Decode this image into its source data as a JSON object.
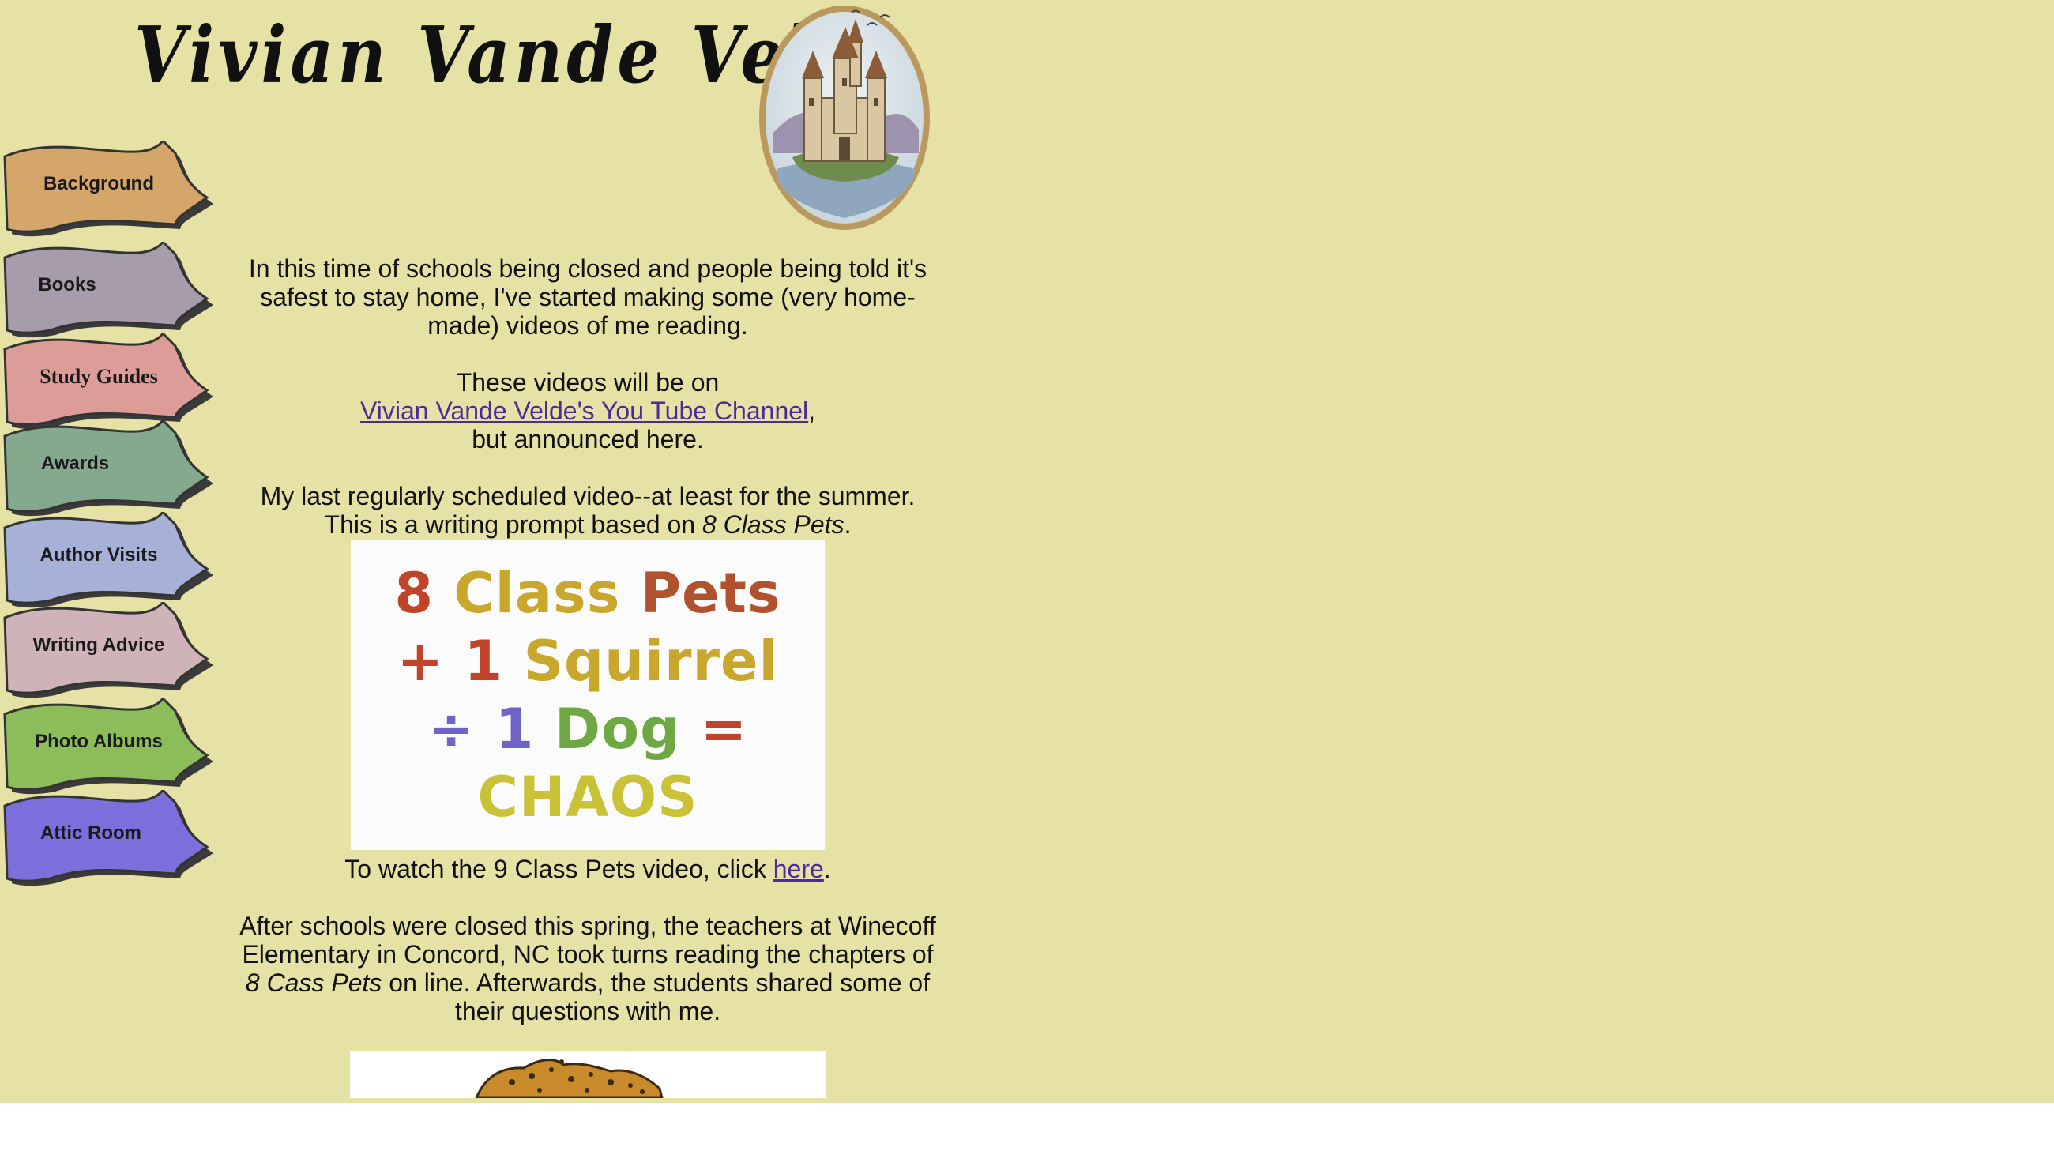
{
  "site": {
    "title": "Vivian Vande Velde",
    "logo_icon": "castle-on-island-oval-icon"
  },
  "nav": {
    "items": [
      {
        "label": "Background",
        "color": "#d4a66a"
      },
      {
        "label": "Books",
        "color": "#a69cab"
      },
      {
        "label": "Study Guides",
        "color": "#dc9c98"
      },
      {
        "label": "Awards",
        "color": "#85a98f"
      },
      {
        "label": "Author Visits",
        "color": "#a7b0d6"
      },
      {
        "label": "Writing Advice",
        "color": "#cfb3b8"
      },
      {
        "label": "Photo Albums",
        "color": "#8dbd5b"
      },
      {
        "label": "Attic Room",
        "color": "#7d6fdb"
      }
    ]
  },
  "main": {
    "intro": "In this time of schools being closed and people being told it's safest to stay home, I've started making some (very home-made) videos of me reading.",
    "videos_on": "These videos will be on",
    "channel_link": "Vivian Vande Velde's You Tube Channel",
    "channel_after": ",",
    "announced": "but announced here.",
    "last_video": "My last regularly scheduled video--at least for the summer.",
    "prompt_before": "This is a writing prompt based on ",
    "prompt_title": "8 Class Pets",
    "prompt_after": ".",
    "promo": {
      "line1": [
        "8 ",
        "Class ",
        "Pets"
      ],
      "line2": [
        "+ 1 ",
        "Squirrel"
      ],
      "line3": [
        "÷ 1 ",
        "Dog ",
        "="
      ],
      "line4": "CHAOS"
    },
    "watch_before": "To watch the 9 Class Pets video, click ",
    "watch_link": "here",
    "watch_after": ".",
    "after_schools_1": "After schools were closed this spring, the teachers at Winecoff Elementary in Concord, NC took turns reading the chapters of ",
    "after_schools_title": "8 Cass Pets",
    "after_schools_2": " on line. Afterwards, the students shared some of their questions with me.",
    "bottom_image_icon": "cheetah-illustration-icon"
  }
}
